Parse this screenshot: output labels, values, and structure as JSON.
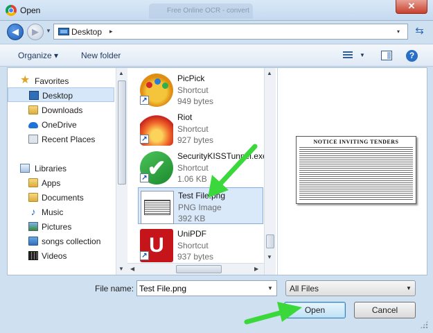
{
  "window": {
    "title": "Open",
    "background_tab_text": "Free Online OCR - convert",
    "close_glyph": "✕"
  },
  "address_bar": {
    "location": "Desktop",
    "separator": "▸",
    "dropdown": "▾"
  },
  "toolbar": {
    "organize_label": "Organize ▾",
    "new_folder_label": "New folder",
    "help_glyph": "?"
  },
  "sidebar": {
    "items": [
      {
        "label": "Favorites",
        "icon": "star-icon",
        "type": "header"
      },
      {
        "label": "Desktop",
        "icon": "desktop-icon",
        "selected": true
      },
      {
        "label": "Downloads",
        "icon": "folder-icon"
      },
      {
        "label": "OneDrive",
        "icon": "cloud-icon"
      },
      {
        "label": "Recent Places",
        "icon": "recent-places-icon"
      },
      {
        "label": "Libraries",
        "icon": "libraries-icon",
        "type": "header"
      },
      {
        "label": "Apps",
        "icon": "folder-icon"
      },
      {
        "label": "Documents",
        "icon": "folder-icon"
      },
      {
        "label": "Music",
        "icon": "music-note-icon"
      },
      {
        "label": "Pictures",
        "icon": "pictures-icon"
      },
      {
        "label": "songs collection",
        "icon": "library-folder-icon"
      },
      {
        "label": "Videos",
        "icon": "film-icon"
      }
    ]
  },
  "files": [
    {
      "name": "PicPick",
      "type": "Shortcut",
      "size": "949 bytes",
      "icon": "picpick-icon"
    },
    {
      "name": "Riot",
      "type": "Shortcut",
      "size": "927 bytes",
      "icon": "riot-icon"
    },
    {
      "name": "SecurityKISSTunnel.exe",
      "type": "Shortcut",
      "size": "1.06 KB",
      "icon": "securitykiss-icon"
    },
    {
      "name": "Test File.png",
      "type": "PNG Image",
      "size": "392 KB",
      "icon": "png-thumbnail-icon",
      "selected": true
    },
    {
      "name": "UniPDF",
      "type": "Shortcut",
      "size": "937 bytes",
      "icon": "unipdf-icon"
    }
  ],
  "icon_glyphs": {
    "shortcut": "↗",
    "check": "✔",
    "unipdf": "U"
  },
  "preview": {
    "title": "NOTICE INVITING TENDERS"
  },
  "bottom": {
    "file_name_label": "File name:",
    "file_name_value": "Test File.png",
    "file_type_value": "All Files",
    "open_label": "Open",
    "cancel_label": "Cancel"
  },
  "colors": {
    "window_frame": "#cfe0f1",
    "selection": "#d9e9fa",
    "annotation_arrow": "#3ad83a",
    "close_button": "#c7402c"
  }
}
